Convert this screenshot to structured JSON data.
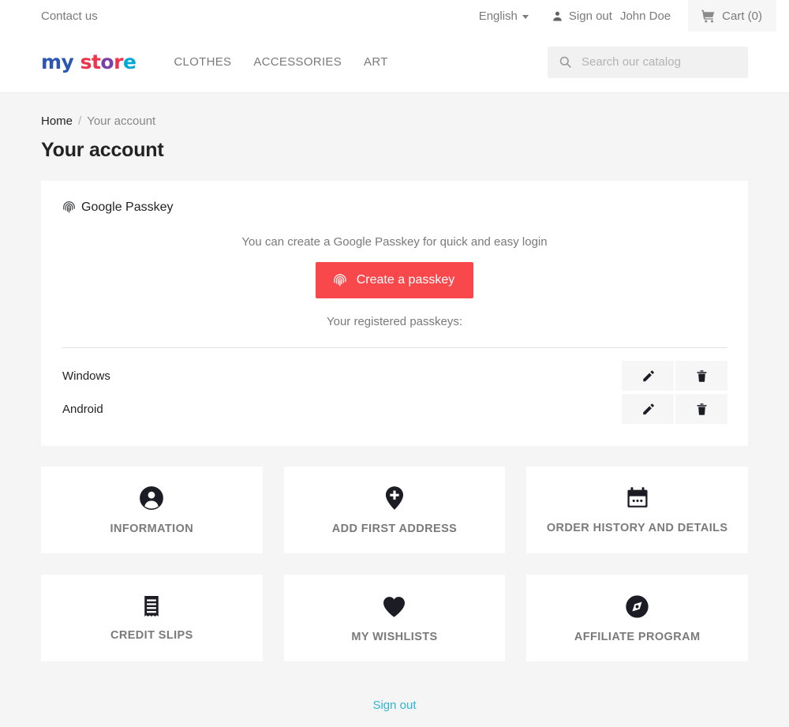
{
  "topbar": {
    "contact_label": "Contact us",
    "language": "English",
    "language_caret_icon": "chevron-down-icon",
    "user_icon": "user-icon",
    "signout_label": "Sign out",
    "user_name": "John Doe",
    "cart_icon": "shopping-cart-icon",
    "cart_label": "Cart (0)"
  },
  "header": {
    "logo": {
      "part1": "my",
      "part2": " st",
      "part3": "o",
      "part4": "r",
      "part5": "e",
      "colors": {
        "blue": "#2b57b0",
        "red": "#f0324b",
        "purple": "#7a3fa8",
        "cyan": "#00a9d4"
      }
    },
    "nav": [
      {
        "label": "CLOTHES"
      },
      {
        "label": "ACCESSORIES"
      },
      {
        "label": "ART"
      }
    ],
    "search": {
      "icon": "search-icon",
      "placeholder": "Search our catalog",
      "value": ""
    }
  },
  "breadcrumb": {
    "home": "Home",
    "separator": "/",
    "current": "Your account"
  },
  "page": {
    "title": "Your account"
  },
  "passkey_card": {
    "header_icon": "fingerprint-icon",
    "header_label": "Google Passkey",
    "description": "You can create a Google Passkey for quick and easy login",
    "create_button": {
      "icon": "fingerprint-icon",
      "label": "Create a passkey",
      "color": "#f8484b"
    },
    "registered_label": "Your registered passkeys:",
    "passkeys": [
      {
        "name": "Windows",
        "edit_icon": "pencil-icon",
        "delete_icon": "trash-icon"
      },
      {
        "name": "Android",
        "edit_icon": "pencil-icon",
        "delete_icon": "trash-icon"
      }
    ]
  },
  "tiles": [
    {
      "label": "INFORMATION",
      "icon": "person-circle-icon"
    },
    {
      "label": "ADD FIRST ADDRESS",
      "icon": "map-pin-plus-icon"
    },
    {
      "label": "ORDER HISTORY AND DETAILS",
      "icon": "calendar-icon"
    },
    {
      "label": "CREDIT SLIPS",
      "icon": "receipt-icon"
    },
    {
      "label": "MY WISHLISTS",
      "icon": "heart-icon"
    },
    {
      "label": "AFFILIATE PROGRAM",
      "icon": "compass-icon"
    }
  ],
  "footer": {
    "signout_label": "Sign out",
    "signout_color": "#2fb5d2"
  }
}
